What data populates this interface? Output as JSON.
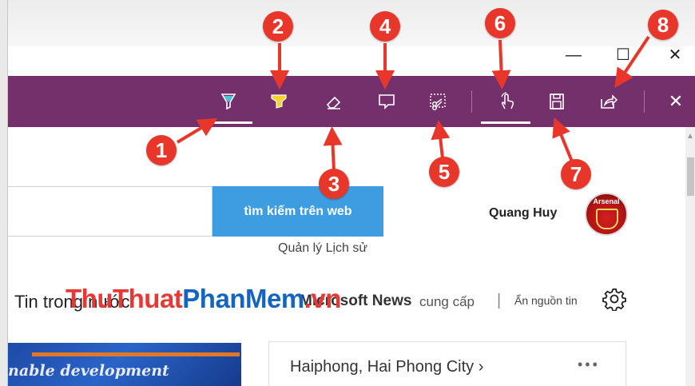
{
  "window": {
    "minimize_glyph": "—",
    "maximize_glyph": "☐",
    "close_glyph": "✕"
  },
  "toolbar": {
    "background": "#74306b",
    "tools": [
      {
        "name": "ballpoint-pen",
        "icon": "pen-icon"
      },
      {
        "name": "highlighter",
        "icon": "highlighter-icon"
      },
      {
        "name": "eraser",
        "icon": "eraser-icon"
      },
      {
        "name": "add-note",
        "icon": "note-icon"
      },
      {
        "name": "clip",
        "icon": "clip-icon"
      },
      {
        "name": "touch-writing",
        "icon": "touch-icon"
      },
      {
        "name": "save-web-note",
        "icon": "save-icon"
      },
      {
        "name": "share-web-note",
        "icon": "share-icon"
      },
      {
        "name": "exit",
        "icon": "close-icon"
      }
    ],
    "close_glyph": "✕"
  },
  "callouts": [
    "1",
    "2",
    "3",
    "4",
    "5",
    "6",
    "7",
    "8"
  ],
  "search": {
    "button_label": "tìm kiếm trên web",
    "history_link": "Quản lý Lịch sử"
  },
  "user": {
    "name": "Quang Huy",
    "avatar_text": "Arsenal"
  },
  "news": {
    "title": "Tin trong nước",
    "provider": "Microsoft News",
    "provider_suffix": "cung cấp",
    "divider": "|",
    "hide_source": "Ẩn nguồn tin",
    "settings_icon": "gear-icon",
    "image_caption": "nable development"
  },
  "watermark": {
    "part1": "ThuThuat",
    "part2": "PhanMem",
    "part3": ".vn"
  },
  "weather": {
    "city": "Haiphong, Hai Phong City",
    "chevron": "›",
    "more": "•••"
  },
  "colors": {
    "accent": "#74306b",
    "search_button": "#3d9de0",
    "callout": "#e8362a",
    "highlighter": "#f5d230",
    "pen": "#46c6dc"
  }
}
